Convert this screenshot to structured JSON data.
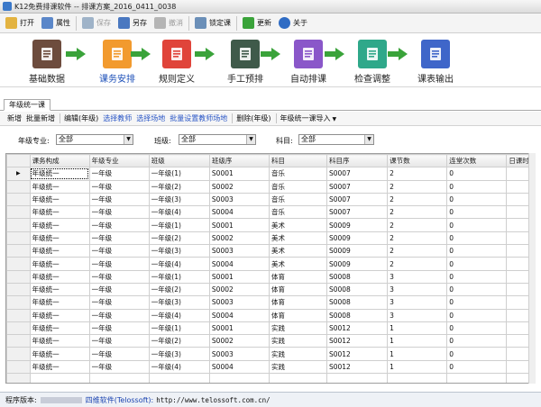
{
  "window": {
    "title": "K12免费排课软件 -- 排课方案_2016_0411_0038"
  },
  "toolbar": {
    "items": [
      {
        "label": "打开",
        "icon": "folder-open-icon",
        "color": "#e3b341",
        "enabled": true
      },
      {
        "label": "属性",
        "icon": "properties-icon",
        "color": "#5b87c9",
        "enabled": true
      },
      {
        "label": "保存",
        "icon": "save-icon",
        "color": "#9fb3c8",
        "enabled": false
      },
      {
        "label": "另存",
        "icon": "save-as-icon",
        "color": "#4a78c0",
        "enabled": true
      },
      {
        "label": "撤消",
        "icon": "undo-icon",
        "color": "#b5b5b5",
        "enabled": false
      },
      {
        "label": "锁定课",
        "icon": "lock-calendar-icon",
        "color": "#6b8fb8",
        "enabled": true
      },
      {
        "label": "更新",
        "icon": "update-arrow-icon",
        "color": "#3aa33a",
        "enabled": true
      },
      {
        "label": "关于",
        "icon": "info-icon",
        "color": "#2f6cc4",
        "enabled": true
      }
    ]
  },
  "workflow": {
    "steps": [
      {
        "label": "基础数据",
        "icon": "books-icon",
        "color": "#6d4c3d",
        "active": false
      },
      {
        "label": "课务安排",
        "icon": "clipboard-icon",
        "color": "#f29a2e",
        "active": true
      },
      {
        "label": "规则定义",
        "icon": "document-icon",
        "color": "#e0443a",
        "active": false
      },
      {
        "label": "手工预排",
        "icon": "schedule-board-icon",
        "color": "#3f5a4a",
        "active": false
      },
      {
        "label": "自动排课",
        "icon": "auto-list-icon",
        "color": "#8a57c9",
        "active": false
      },
      {
        "label": "检查调整",
        "icon": "users-check-icon",
        "color": "#2fa88a",
        "active": false
      },
      {
        "label": "课表输出",
        "icon": "report-icon",
        "color": "#3f66c9",
        "active": false
      }
    ],
    "arrow_color": "#3aa33a"
  },
  "tabs": [
    {
      "label": "年级统一课"
    }
  ],
  "actions": [
    {
      "label": "新增",
      "link": false
    },
    {
      "label": "批量新增",
      "link": false
    },
    {
      "label": "编辑(年级)",
      "link": false
    },
    {
      "label": "选择教师",
      "link": true
    },
    {
      "label": "选择场地",
      "link": true
    },
    {
      "label": "批量设置教师场地",
      "link": true
    },
    {
      "label": "删除(年级)",
      "link": false
    },
    {
      "label": "年级统一课导入",
      "link": false,
      "dropdown": true
    }
  ],
  "filters": {
    "grade_label": "年级专业:",
    "grade_value": "全部",
    "class_label": "班级:",
    "class_value": "全部",
    "subject_label": "科目:",
    "subject_value": "全部"
  },
  "table": {
    "columns": [
      "课务构成",
      "年级专业",
      "班级",
      "班级序",
      "科目",
      "科目序",
      "课节数",
      "连堂次数",
      "日课时均匀组"
    ],
    "rows": [
      [
        "年级统一",
        "一年级",
        "一年级(1)",
        "S0001",
        "音乐",
        "S0007",
        "2",
        "0",
        ""
      ],
      [
        "年级统一",
        "一年级",
        "一年级(2)",
        "S0002",
        "音乐",
        "S0007",
        "2",
        "0",
        ""
      ],
      [
        "年级统一",
        "一年级",
        "一年级(3)",
        "S0003",
        "音乐",
        "S0007",
        "2",
        "0",
        ""
      ],
      [
        "年级统一",
        "一年级",
        "一年级(4)",
        "S0004",
        "音乐",
        "S0007",
        "2",
        "0",
        ""
      ],
      [
        "年级统一",
        "一年级",
        "一年级(1)",
        "S0001",
        "美术",
        "S0009",
        "2",
        "0",
        ""
      ],
      [
        "年级统一",
        "一年级",
        "一年级(2)",
        "S0002",
        "美术",
        "S0009",
        "2",
        "0",
        ""
      ],
      [
        "年级统一",
        "一年级",
        "一年级(3)",
        "S0003",
        "美术",
        "S0009",
        "2",
        "0",
        ""
      ],
      [
        "年级统一",
        "一年级",
        "一年级(4)",
        "S0004",
        "美术",
        "S0009",
        "2",
        "0",
        ""
      ],
      [
        "年级统一",
        "一年级",
        "一年级(1)",
        "S0001",
        "体育",
        "S0008",
        "3",
        "0",
        ""
      ],
      [
        "年级统一",
        "一年级",
        "一年级(2)",
        "S0002",
        "体育",
        "S0008",
        "3",
        "0",
        ""
      ],
      [
        "年级统一",
        "一年级",
        "一年级(3)",
        "S0003",
        "体育",
        "S0008",
        "3",
        "0",
        ""
      ],
      [
        "年级统一",
        "一年级",
        "一年级(4)",
        "S0004",
        "体育",
        "S0008",
        "3",
        "0",
        ""
      ],
      [
        "年级统一",
        "一年级",
        "一年级(1)",
        "S0001",
        "实践",
        "S0012",
        "1",
        "0",
        ""
      ],
      [
        "年级统一",
        "一年级",
        "一年级(2)",
        "S0002",
        "实践",
        "S0012",
        "1",
        "0",
        ""
      ],
      [
        "年级统一",
        "一年级",
        "一年级(3)",
        "S0003",
        "实践",
        "S0012",
        "1",
        "0",
        ""
      ],
      [
        "年级统一",
        "一年级",
        "一年级(4)",
        "S0004",
        "实践",
        "S0012",
        "1",
        "0",
        ""
      ],
      [
        "",
        "",
        "",
        "",
        "",
        "",
        "",
        "",
        ""
      ]
    ]
  },
  "status": {
    "version_label": "程序版本:",
    "company": "四维软件(Telossoft):",
    "url": "http://www.telossoft.com.cn/"
  }
}
